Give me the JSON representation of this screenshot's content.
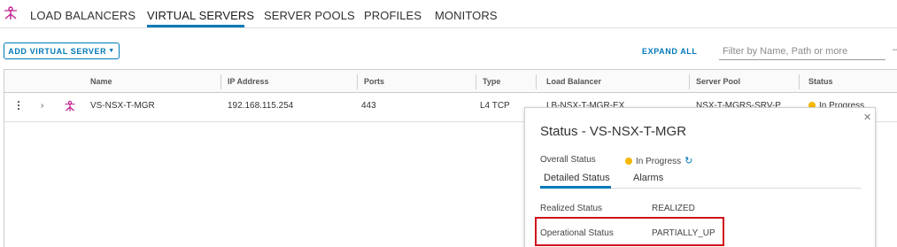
{
  "tabs": [
    {
      "label": "LOAD BALANCERS",
      "active": false
    },
    {
      "label": "VIRTUAL SERVERS",
      "active": true
    },
    {
      "label": "SERVER POOLS",
      "active": false
    },
    {
      "label": "PROFILES",
      "active": false
    },
    {
      "label": "MONITORS",
      "active": false
    }
  ],
  "toolbar": {
    "add_label": "ADD VIRTUAL SERVER",
    "expand_all_label": "EXPAND ALL",
    "filter_placeholder": "Filter by Name, Path or more"
  },
  "grid": {
    "columns": [
      "Name",
      "IP Address",
      "Ports",
      "Type",
      "Load Balancer",
      "Server Pool",
      "Status"
    ],
    "rows": [
      {
        "name": "VS-NSX-T-MGR",
        "ip": "192.168.115.254",
        "ports": "443",
        "type": "L4 TCP",
        "load_balancer": "LB-NSX-T-MGR-EX",
        "server_pool": "NSX-T-MGRS-SRV-P",
        "status": "In Progress"
      }
    ]
  },
  "popover": {
    "title": "Status - VS-NSX-T-MGR",
    "overall_label": "Overall Status",
    "overall_value": "In Progress",
    "tabs": [
      "Detailed Status",
      "Alarms"
    ],
    "realized_label": "Realized Status",
    "realized_value": "REALIZED",
    "operational_label": "Operational Status",
    "operational_value": "PARTIALLY_UP"
  },
  "colors": {
    "accent": "#0079b8",
    "status_in_progress": "#f5b800",
    "highlight": "#d0111b",
    "lb_icon": "#c21d8e"
  },
  "icons": [
    "load-balancer-icon",
    "kebab-menu-icon",
    "chevron-right-icon",
    "virtual-server-icon",
    "refresh-icon",
    "info-icon",
    "close-icon",
    "chevron-down-icon"
  ]
}
